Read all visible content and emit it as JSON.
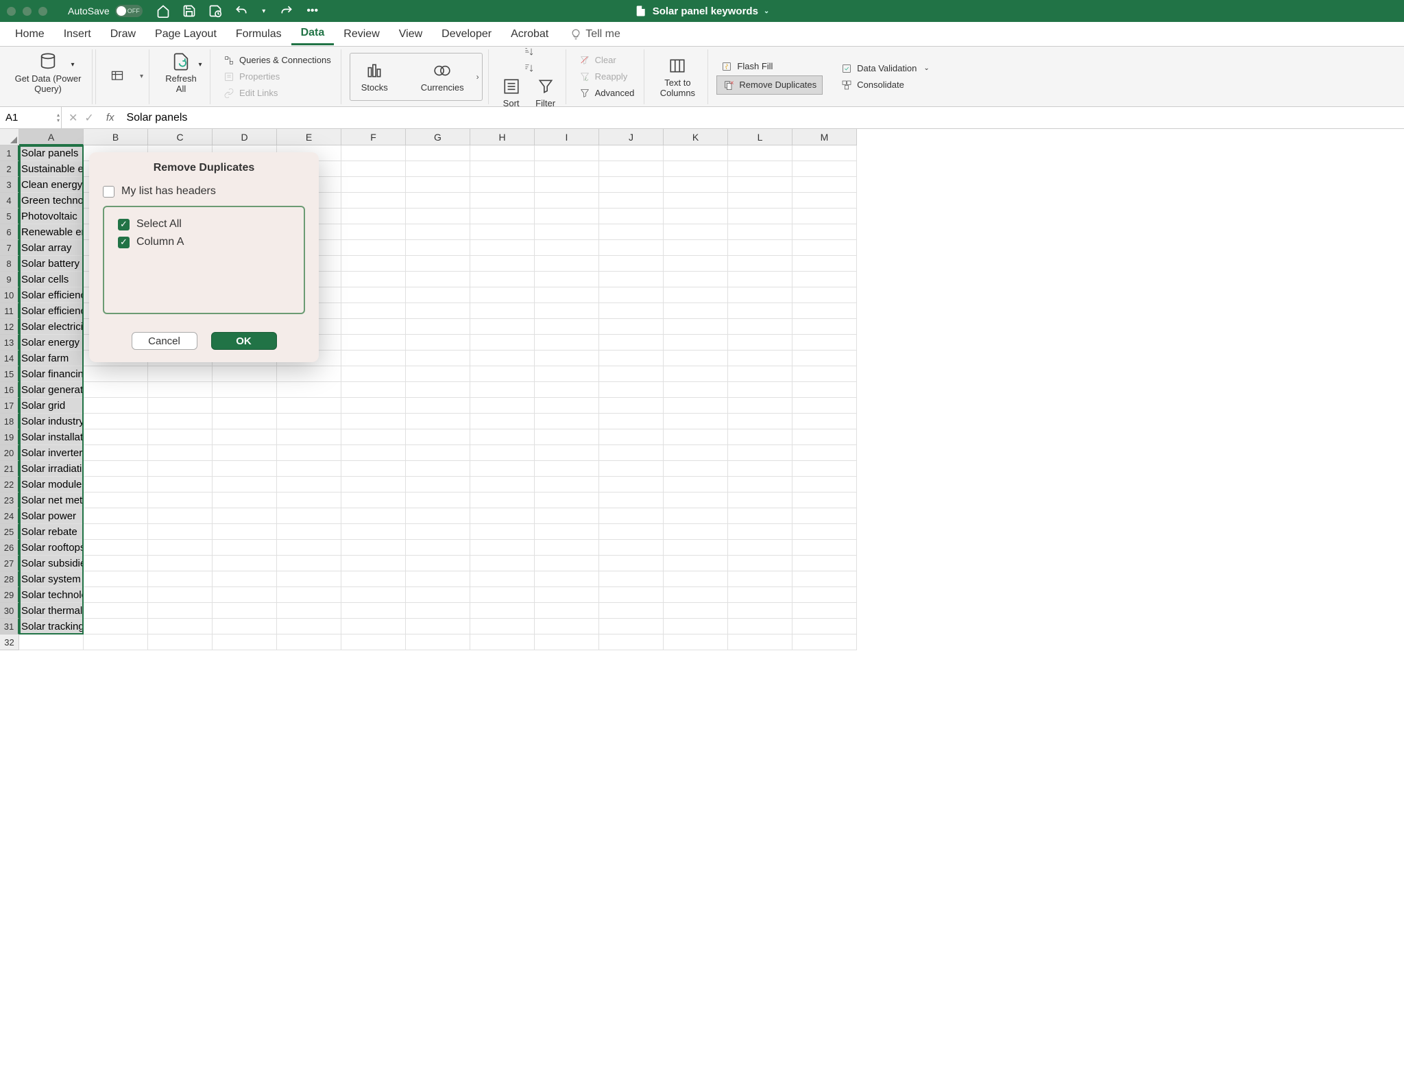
{
  "titlebar": {
    "autosave_label": "AutoSave",
    "autosave_state": "OFF",
    "filename": "Solar panel keywords"
  },
  "tabs": [
    "Home",
    "Insert",
    "Draw",
    "Page Layout",
    "Formulas",
    "Data",
    "Review",
    "View",
    "Developer",
    "Acrobat"
  ],
  "tellme": "Tell me",
  "ribbon": {
    "get_data": "Get Data (Power Query)",
    "refresh": "Refresh All",
    "queries": "Queries & Connections",
    "properties": "Properties",
    "edit_links": "Edit Links",
    "stocks": "Stocks",
    "currencies": "Currencies",
    "sort": "Sort",
    "filter": "Filter",
    "clear": "Clear",
    "reapply": "Reapply",
    "advanced": "Advanced",
    "text_to_columns": "Text to Columns",
    "flash_fill": "Flash Fill",
    "remove_duplicates": "Remove Duplicates",
    "data_validation": "Data Validation",
    "consolidate": "Consolidate"
  },
  "namebox": "A1",
  "formula": "Solar panels",
  "columns": [
    "A",
    "B",
    "C",
    "D",
    "E",
    "F",
    "G",
    "H",
    "I",
    "J",
    "K",
    "L",
    "M"
  ],
  "rows": [
    "Solar panels",
    "Sustainable energy",
    "Clean energy",
    "Green technology",
    "Photovoltaic",
    "Renewable energy",
    "Solar array",
    "Solar battery",
    "Solar cells",
    "Solar efficiency",
    "Solar efficiency",
    "Solar electricity",
    "Solar energy",
    "Solar farm",
    "Solar financing",
    "Solar generation",
    "Solar grid",
    "Solar industry",
    "Solar installation",
    "Solar inverter",
    "Solar irradiation",
    "Solar modules",
    "Solar net metering",
    "Solar power",
    "Solar rebate",
    "Solar rooftops",
    "Solar subsidies",
    "Solar system",
    "Solar technology",
    "Solar thermal",
    "Solar tracking"
  ],
  "dialog": {
    "title": "Remove Duplicates",
    "headers_label": "My list has headers",
    "select_all": "Select All",
    "column_a": "Column A",
    "cancel": "Cancel",
    "ok": "OK"
  }
}
